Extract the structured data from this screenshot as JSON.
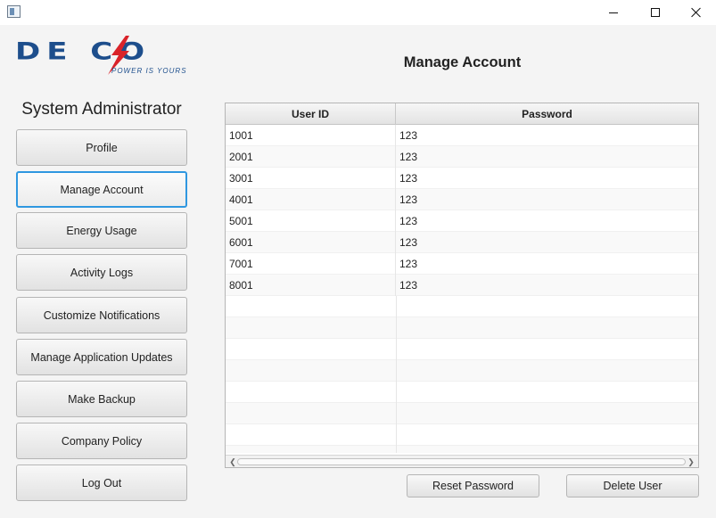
{
  "window": {
    "controls": {
      "minimize_icon": "minimize-icon",
      "maximize_icon": "maximize-icon",
      "close_icon": "close-icon"
    }
  },
  "logo": {
    "wordmark": "DE CO",
    "tagline": "POWER IS YOURS",
    "colors": {
      "blue": "#1d4e8c",
      "red": "#d9232a"
    }
  },
  "sidebar": {
    "role_title": "System Administrator",
    "items": [
      {
        "label": "Profile"
      },
      {
        "label": "Manage Account",
        "focused": true
      },
      {
        "label": "Energy Usage"
      },
      {
        "label": "Activity Logs"
      },
      {
        "label": "Customize Notifications"
      },
      {
        "label": "Manage Application Updates"
      },
      {
        "label": "Make Backup"
      },
      {
        "label": "Company Policy"
      },
      {
        "label": "Log Out"
      }
    ]
  },
  "main": {
    "title": "Manage Account",
    "table": {
      "columns": [
        "User ID",
        "Password"
      ],
      "rows": [
        [
          "1001",
          "123"
        ],
        [
          "2001",
          "123"
        ],
        [
          "3001",
          "123"
        ],
        [
          "4001",
          "123"
        ],
        [
          "5001",
          "123"
        ],
        [
          "6001",
          "123"
        ],
        [
          "7001",
          "123"
        ],
        [
          "8001",
          "123"
        ]
      ]
    },
    "actions": {
      "reset_password": "Reset Password",
      "delete_user": "Delete User"
    }
  },
  "colors": {
    "focus_accent": "#2f97e0",
    "background": "#f4f4f4"
  }
}
